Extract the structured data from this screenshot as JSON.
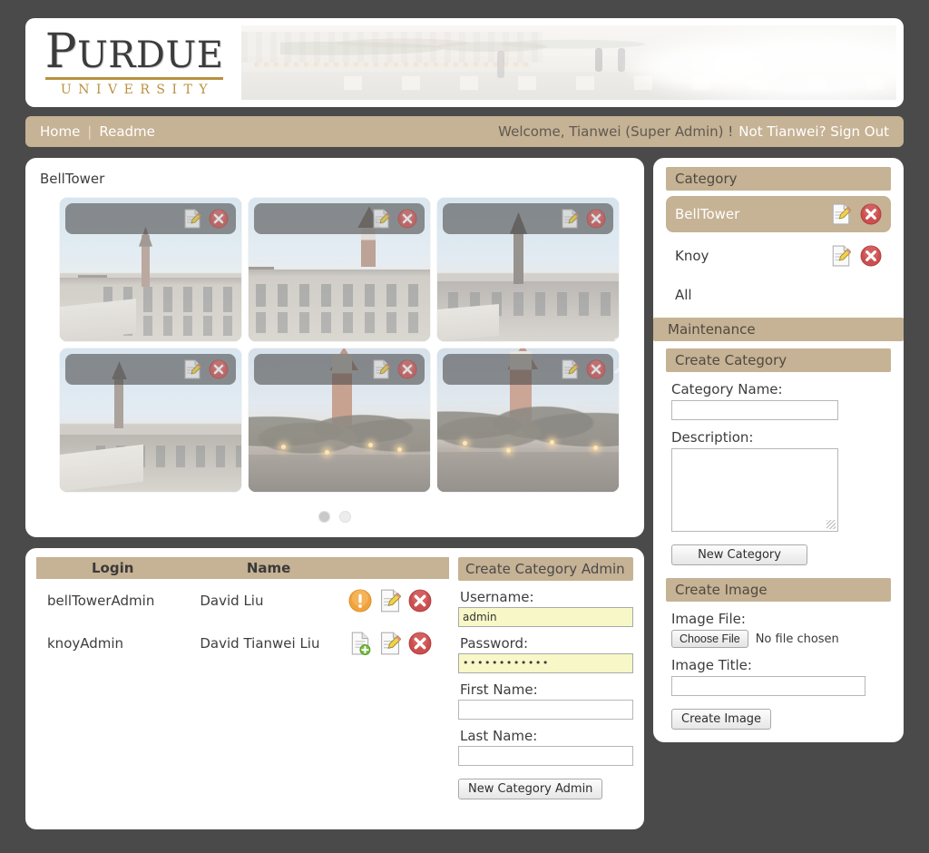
{
  "brand": {
    "wordmark_cap": "P",
    "wordmark_rest": "URDUE",
    "university": "UNIVERSITY",
    "banner_alt": "purdue-fountain-banner",
    "gold": "#b8913f",
    "tan": "#c6b294",
    "page_bg": "#4a4a4a"
  },
  "nav": {
    "home": "Home",
    "separator": "|",
    "readme": "Readme",
    "welcome": "Welcome, Tianwei (Super Admin) !",
    "signout": "Not Tianwei? Sign Out"
  },
  "gallery": {
    "title": "BellTower",
    "thumbs": [
      {
        "scene": "sceneA",
        "edit": "edit-icon",
        "delete": "delete-icon"
      },
      {
        "scene": "sceneB",
        "edit": "edit-icon",
        "delete": "delete-icon"
      },
      {
        "scene": "sceneC",
        "edit": "edit-icon",
        "delete": "delete-icon"
      },
      {
        "scene": "sceneD",
        "edit": "edit-icon",
        "delete": "delete-icon"
      },
      {
        "scene": "sceneE",
        "edit": "edit-icon",
        "delete": "delete-icon"
      },
      {
        "scene": "sceneF",
        "edit": "edit-icon",
        "delete": "delete-icon"
      }
    ],
    "prev_icon": "chevron-left-icon",
    "next_icon": "chevron-right-icon",
    "dots": [
      {
        "active": true
      },
      {
        "active": false
      }
    ]
  },
  "admin_table": {
    "columns": [
      "Login",
      "Name",
      ""
    ],
    "rows": [
      {
        "login": "bellTowerAdmin",
        "name": "David Liu",
        "actions": [
          "warning-icon",
          "edit-icon",
          "delete-icon"
        ]
      },
      {
        "login": "knoyAdmin",
        "name": "David Tianwei Liu",
        "actions": [
          "add-document-icon",
          "edit-icon",
          "delete-icon"
        ]
      }
    ]
  },
  "create_category_admin": {
    "title": "Create Category Admin",
    "username_label": "Username:",
    "username_value": "admin",
    "password_label": "Password:",
    "password_value": "••••••••••••",
    "firstname_label": "First Name:",
    "firstname_value": "",
    "lastname_label": "Last Name:",
    "lastname_value": "",
    "submit_label": "New Category Admin"
  },
  "sidebar": {
    "category_header": "Category",
    "categories": [
      {
        "name": "BellTower",
        "selected": true,
        "edit": "edit-icon",
        "delete": "delete-icon"
      },
      {
        "name": "Knoy",
        "selected": false,
        "edit": "edit-icon",
        "delete": "delete-icon"
      },
      {
        "name": "All",
        "selected": false
      }
    ],
    "maintenance_header": "Maintenance",
    "create_category": {
      "title": "Create Category",
      "name_label": "Category Name:",
      "name_value": "",
      "description_label": "Description:",
      "description_value": "",
      "submit_label": "New Category"
    },
    "create_image": {
      "title": "Create Image",
      "file_label": "Image File:",
      "choose_file_label": "Choose File",
      "no_file_text": "No file chosen",
      "title_label": "Image Title:",
      "title_value": "",
      "submit_label": "Create Image"
    }
  }
}
